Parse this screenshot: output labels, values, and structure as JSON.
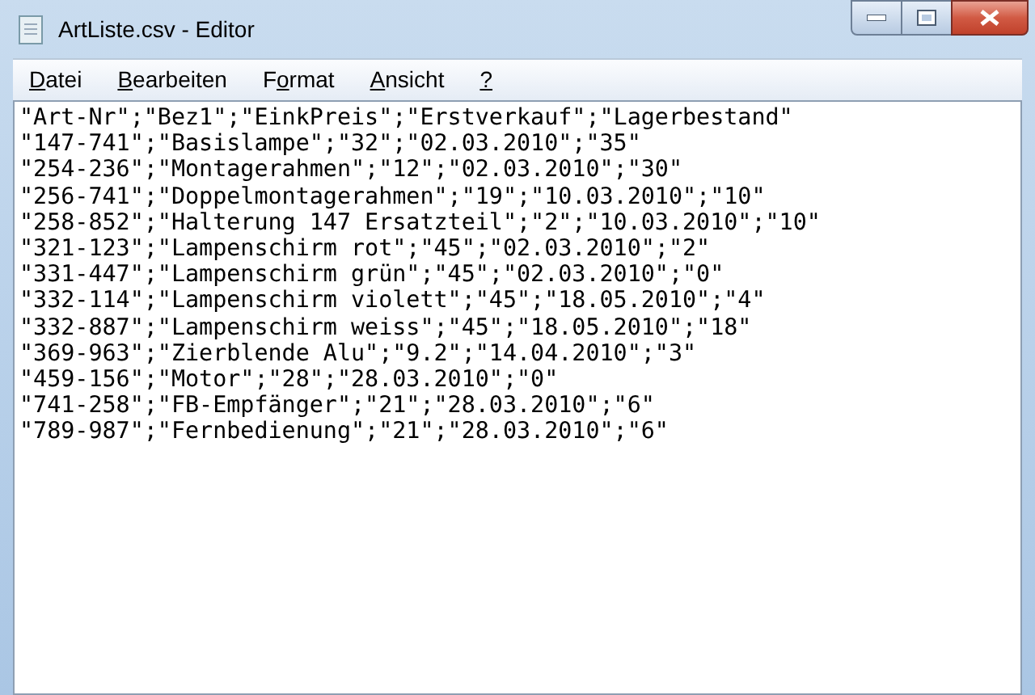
{
  "window": {
    "title": "ArtListe.csv - Editor"
  },
  "menu": [
    {
      "key": "D",
      "after": "atei"
    },
    {
      "key": "B",
      "after": "earbeiten"
    },
    {
      "before": "F",
      "key": "o",
      "after": "rmat"
    },
    {
      "key": "A",
      "after": "nsicht"
    },
    {
      "key": "?"
    }
  ],
  "editor": {
    "lines": [
      "\"Art-Nr\";\"Bez1\";\"EinkPreis\";\"Erstverkauf\";\"Lagerbestand\"",
      "\"147-741\";\"Basislampe\";\"32\";\"02.03.2010\";\"35\"",
      "\"254-236\";\"Montagerahmen\";\"12\";\"02.03.2010\";\"30\"",
      "\"256-741\";\"Doppelmontagerahmen\";\"19\";\"10.03.2010\";\"10\"",
      "\"258-852\";\"Halterung 147 Ersatzteil\";\"2\";\"10.03.2010\";\"10\"",
      "\"321-123\";\"Lampenschirm rot\";\"45\";\"02.03.2010\";\"2\"",
      "\"331-447\";\"Lampenschirm grün\";\"45\";\"02.03.2010\";\"0\"",
      "\"332-114\";\"Lampenschirm violett\";\"45\";\"18.05.2010\";\"4\"",
      "\"332-887\";\"Lampenschirm weiss\";\"45\";\"18.05.2010\";\"18\"",
      "\"369-963\";\"Zierblende Alu\";\"9.2\";\"14.04.2010\";\"3\"",
      "\"459-156\";\"Motor\";\"28\";\"28.03.2010\";\"0\"",
      "\"741-258\";\"FB-Empfänger\";\"21\";\"28.03.2010\";\"6\"",
      "\"789-987\";\"Fernbedienung\";\"21\";\"28.03.2010\";\"6\""
    ]
  }
}
